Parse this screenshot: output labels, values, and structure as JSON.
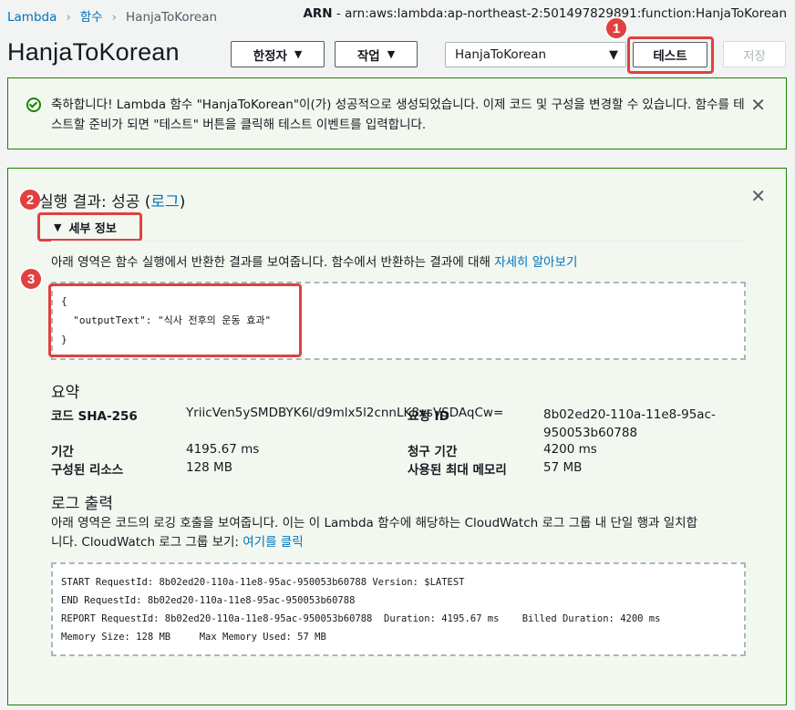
{
  "breadcrumb": {
    "root": "Lambda",
    "section": "함수",
    "current": "HanjaToKorean"
  },
  "arn": {
    "label": "ARN",
    "value": "arn:aws:lambda:ap-northeast-2:501497829891:function:HanjaToKorean"
  },
  "page_title": "HanjaToKorean",
  "toolbar": {
    "qualifiers_label": "한정자",
    "actions_label": "작업",
    "test_event_selected": "HanjaToKorean",
    "test_label": "테스트",
    "save_label": "저장"
  },
  "banner": {
    "message": "축하합니다! Lambda 함수 \"HanjaToKorean\"이(가) 성공적으로 생성되었습니다. 이제 코드 및 구성을 변경할 수 있습니다. 함수를 테스트할 준비가 되면 \"테스트\" 버튼을 클릭해 테스트 이벤트를 입력합니다."
  },
  "annotations": [
    "1",
    "2",
    "3"
  ],
  "result": {
    "title_prefix": "실행 결과: 성공 (",
    "logs_link": "로그",
    "title_suffix": ")",
    "details_label": "세부 정보",
    "description": "아래 영역은 함수 실행에서 반환한 결과를 보여줍니다. 함수에서 반환하는 결과에 대해 ",
    "learn_more": "자세히 알아보기",
    "output_lines": [
      "{",
      "  \"outputText\": \"식사 전후의 운동 효과\"",
      "}"
    ]
  },
  "summary": {
    "heading": "요약",
    "code_sha_label": "코드 SHA-256",
    "code_sha_value": "YriicVen5ySMDBYK6l/d9mlx5l2cnnLK8vsVSDAqCw=",
    "request_id_label": "요청 ID",
    "request_id_value": "8b02ed20-110a-11e8-95ac-950053b60788",
    "duration_label": "기간",
    "duration_value": "4195.67 ms",
    "billed_label": "청구 기간",
    "billed_value": "4200 ms",
    "resources_label": "구성된 리소스",
    "resources_value": "128 MB",
    "max_memory_label": "사용된 최대 메모리",
    "max_memory_value": "57 MB"
  },
  "log": {
    "heading": "로그 출력",
    "description_line1": "아래 영역은 코드의 로깅 호출을 보여줍니다. 이는 이 Lambda 함수에 해당하는 CloudWatch 로그 그룹 내 단일 행과 일치합",
    "description_line2": "니다. CloudWatch 로그 그룹 보기: ",
    "link": "여기를 클릭",
    "lines": [
      "START RequestId: 8b02ed20-110a-11e8-95ac-950053b60788 Version: $LATEST",
      "END RequestId: 8b02ed20-110a-11e8-95ac-950053b60788",
      "REPORT RequestId: 8b02ed20-110a-11e8-95ac-950053b60788  Duration: 4195.67 ms    Billed Duration: 4200 ms",
      "Memory Size: 128 MB     Max Memory Used: 57 MB"
    ]
  },
  "icons": {
    "success": "check-circle-icon",
    "close": "close-icon",
    "dropdown": "caret-down-icon",
    "expand": "triangle-down-icon"
  },
  "colors": {
    "accent": "#0073bb",
    "success_border": "#1d8102",
    "annotation": "#e0403f"
  }
}
